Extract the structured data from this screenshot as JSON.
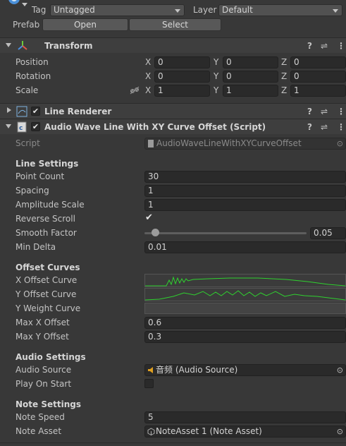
{
  "header": {
    "tag_label": "Tag",
    "tag_value": "Untagged",
    "layer_label": "Layer",
    "layer_value": "Default",
    "prefab_label": "Prefab",
    "open_label": "Open",
    "select_label": "Select"
  },
  "transform": {
    "title": "Transform",
    "position_label": "Position",
    "rotation_label": "Rotation",
    "scale_label": "Scale",
    "axis_x": "X",
    "axis_y": "Y",
    "axis_z": "Z",
    "position": [
      "0",
      "0",
      "0"
    ],
    "rotation": [
      "0",
      "0",
      "0"
    ],
    "scale": [
      "1",
      "1",
      "1"
    ]
  },
  "line_renderer": {
    "title": "Line Renderer",
    "enabled": true
  },
  "script_component": {
    "title": "Audio Wave Line With XY Curve Offset (Script)",
    "enabled": true,
    "script_label": "Script",
    "script_value": "AudioWaveLineWithXYCurveOffset"
  },
  "line_settings": {
    "heading": "Line Settings",
    "point_count_label": "Point Count",
    "point_count": "30",
    "spacing_label": "Spacing",
    "spacing": "1",
    "amplitude_label": "Amplitude Scale",
    "amplitude": "1",
    "reverse_label": "Reverse Scroll",
    "reverse_checked": true,
    "smooth_label": "Smooth Factor",
    "smooth_value": "0.05",
    "smooth_fraction": 0.05,
    "min_delta_label": "Min Delta",
    "min_delta": "0.01"
  },
  "offset_curves": {
    "heading": "Offset Curves",
    "x_curve_label": "X Offset Curve",
    "y_curve_label": "Y Offset Curve",
    "y_weight_label": "Y Weight Curve",
    "max_x_label": "Max X Offset",
    "max_x": "0.6",
    "max_y_label": "Max Y Offset",
    "max_y": "0.3",
    "curve_color": "#2fd12f"
  },
  "audio_settings": {
    "heading": "Audio Settings",
    "source_label": "Audio Source",
    "source_value": "音频 (Audio Source)",
    "play_on_start_label": "Play On Start",
    "play_on_start": false
  },
  "note_settings": {
    "heading": "Note Settings",
    "speed_label": "Note Speed",
    "speed": "5",
    "asset_label": "Note Asset",
    "asset_value": "NoteAsset 1 (Note Asset)"
  },
  "icons": [
    "gameobject-icon",
    "dropdown-arrow-icon",
    "foldout-arrow-icon",
    "transform-axes-icon",
    "help-icon",
    "presets-icon",
    "kebab-menu-icon",
    "line-renderer-icon",
    "script-icon",
    "unlink-icon",
    "object-picker-icon",
    "audio-source-icon",
    "note-asset-icon"
  ]
}
